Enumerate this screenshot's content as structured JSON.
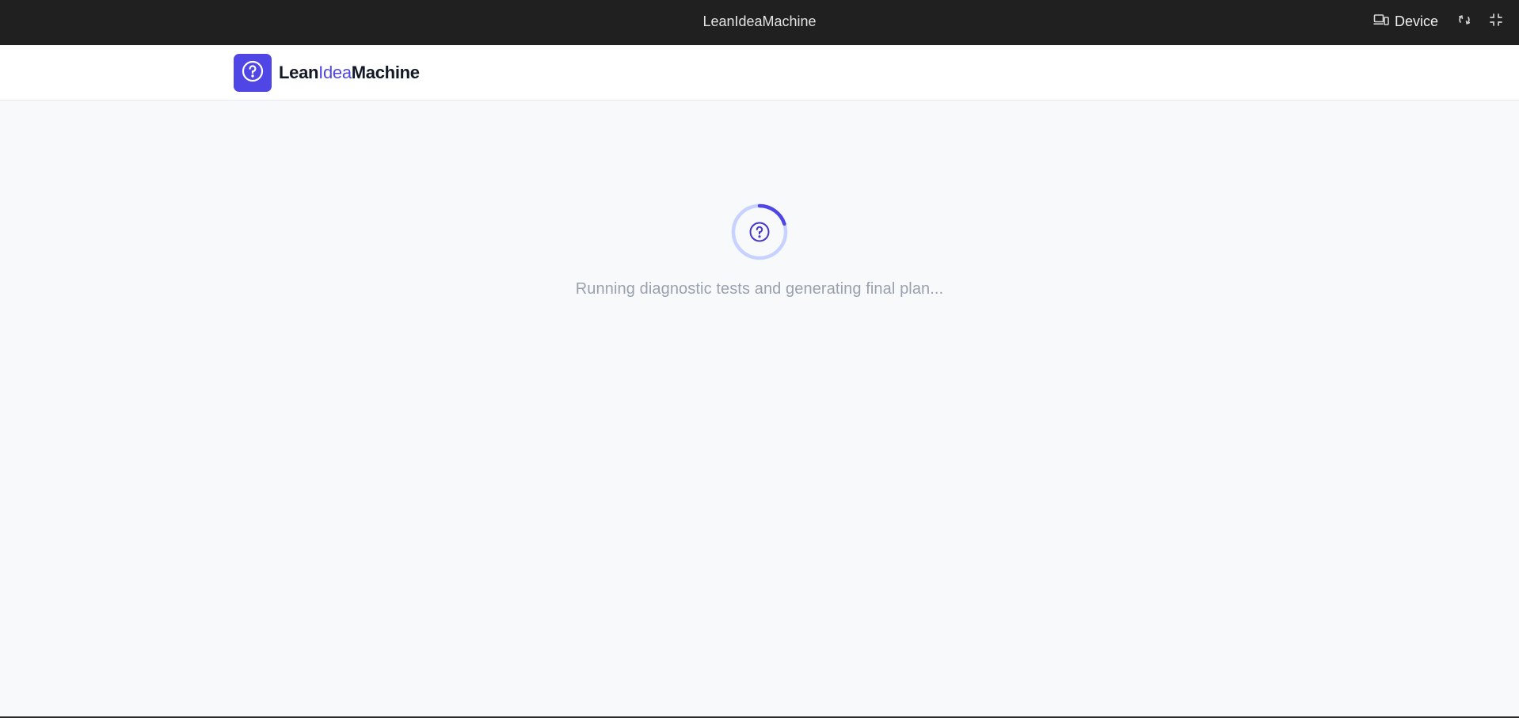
{
  "window": {
    "title": "LeanIdeaMachine"
  },
  "toolbar": {
    "device_label": "Device",
    "icons": {
      "device": "devices-icon",
      "refresh": "refresh-icon",
      "fullscreen": "exit-fullscreen-icon"
    }
  },
  "brand": {
    "part1": "Lean",
    "part2": "Idea",
    "part3": "Machine",
    "icon": "question-circle-icon"
  },
  "loading": {
    "message": "Running diagnostic tests and generating final plan...",
    "icon": "question-circle-icon"
  },
  "colors": {
    "accent": "#4f46e5",
    "topbar": "#202020",
    "background": "#f8f9fb",
    "spinner_track": "#c7d2fe"
  }
}
